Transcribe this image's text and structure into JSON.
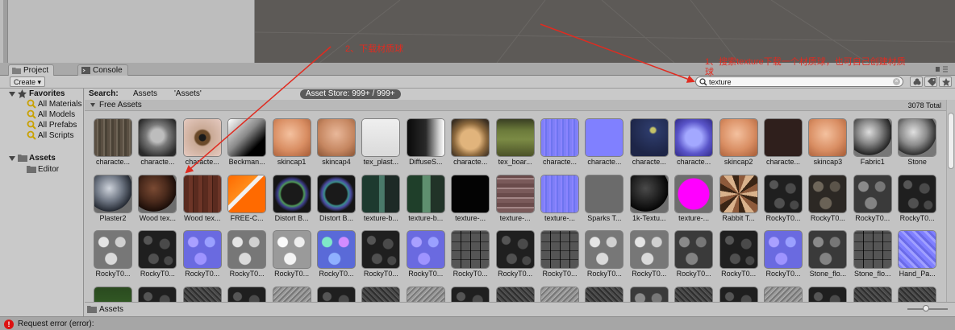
{
  "tabs": [
    {
      "label": "Project"
    },
    {
      "label": "Console"
    }
  ],
  "toolbar": {
    "create_label": "Create",
    "search_value": "texture"
  },
  "sidebar": {
    "favorites_label": "Favorites",
    "favorites": [
      "All Materials",
      "All Models",
      "All Prefabs",
      "All Scripts"
    ],
    "assets_label": "Assets",
    "assets_children": [
      "Editor"
    ]
  },
  "search_scope": {
    "label": "Search:",
    "assets": "Assets",
    "assets_quoted": "'Assets'",
    "asset_store": "Asset Store: 999+ / 999+"
  },
  "group": {
    "title": "Free Assets",
    "total": "3078 Total"
  },
  "assets": [
    {
      "label": "characte...",
      "tex": "bark"
    },
    {
      "label": "characte...",
      "tex": "face-dark"
    },
    {
      "label": "characte...",
      "tex": "eye"
    },
    {
      "label": "Beckman...",
      "tex": "grad-bw"
    },
    {
      "label": "skincap1",
      "tex": "skin"
    },
    {
      "label": "skincap4",
      "tex": "skin2"
    },
    {
      "label": "tex_plast...",
      "tex": "plastic"
    },
    {
      "label": "DiffuseS...",
      "tex": "diffuse"
    },
    {
      "label": "characte...",
      "tex": "face-tan"
    },
    {
      "label": "tex_boar...",
      "tex": "board"
    },
    {
      "label": "characte...",
      "tex": "normal"
    },
    {
      "label": "characte...",
      "tex": "normal-flat"
    },
    {
      "label": "characte...",
      "tex": "navy"
    },
    {
      "label": "characte...",
      "tex": "face-blue"
    },
    {
      "label": "skincap2",
      "tex": "skin"
    },
    {
      "label": "characte...",
      "tex": "dark-brown"
    },
    {
      "label": "skincap3",
      "tex": "skin"
    },
    {
      "label": "Fabric1",
      "tex": "sphere-gray"
    },
    {
      "label": "Stone",
      "tex": "sphere-stone"
    },
    {
      "label": "Plaster2",
      "tex": "sphere-plaster"
    },
    {
      "label": "Wood tex...",
      "tex": "sphere-wood"
    },
    {
      "label": "Wood tex...",
      "tex": "planks"
    },
    {
      "label": "FREE-C...",
      "tex": "orange-uv"
    },
    {
      "label": "Distort B...",
      "tex": "ring"
    },
    {
      "label": "Distort B...",
      "tex": "ring2"
    },
    {
      "label": "texture-b...",
      "tex": "bottle"
    },
    {
      "label": "texture-b...",
      "tex": "bottle2"
    },
    {
      "label": "texture-...",
      "tex": "black"
    },
    {
      "label": "texture-...",
      "tex": "brick"
    },
    {
      "label": "texture-...",
      "tex": "normal"
    },
    {
      "label": "Sparks T...",
      "tex": "gray"
    },
    {
      "label": "1k-Textu...",
      "tex": "sphere-dark"
    },
    {
      "label": "texture-...",
      "tex": "magenta"
    },
    {
      "label": "Rabbit T...",
      "tex": "rabbit"
    },
    {
      "label": "RockyT0...",
      "tex": "rock-dark"
    },
    {
      "label": "RockyT0...",
      "tex": "rock-brown"
    },
    {
      "label": "RockyT0...",
      "tex": "rock-gray"
    },
    {
      "label": "RockyT0...",
      "tex": "rock-dark"
    },
    {
      "label": "RockyT0...",
      "tex": "rock-light"
    },
    {
      "label": "RockyT0...",
      "tex": "rock-dark"
    },
    {
      "label": "RockyT0...",
      "tex": "rock-normal"
    },
    {
      "label": "RockyT0...",
      "tex": "rock-light"
    },
    {
      "label": "RockyT0...",
      "tex": "rock-white"
    },
    {
      "label": "RockyT0...",
      "tex": "rock-rainbow"
    },
    {
      "label": "RockyT0...",
      "tex": "rock-dark"
    },
    {
      "label": "RockyT0...",
      "tex": "rock-normal"
    },
    {
      "label": "RockyT0...",
      "tex": "tile-gray"
    },
    {
      "label": "RockyT0...",
      "tex": "rock-dark"
    },
    {
      "label": "RockyT0...",
      "tex": "tile-gray"
    },
    {
      "label": "RockyT0...",
      "tex": "rock-light"
    },
    {
      "label": "RockyT0...",
      "tex": "rock-light"
    },
    {
      "label": "RockyT0...",
      "tex": "rock-gray"
    },
    {
      "label": "RockyT0...",
      "tex": "rock-dark"
    },
    {
      "label": "RockyT0...",
      "tex": "rock-normal"
    },
    {
      "label": "Stone_flo...",
      "tex": "rock-gray"
    },
    {
      "label": "Stone_flo...",
      "tex": "tile-gray"
    },
    {
      "label": "Hand_Pa...",
      "tex": "normal-wave"
    },
    {
      "label": "",
      "tex": "grass"
    },
    {
      "label": "",
      "tex": "rock-dark"
    },
    {
      "label": "",
      "tex": "noise"
    },
    {
      "label": "",
      "tex": "rock-dark"
    },
    {
      "label": "",
      "tex": "noise-light"
    },
    {
      "label": "",
      "tex": "rock-dark"
    },
    {
      "label": "",
      "tex": "noise"
    },
    {
      "label": "",
      "tex": "noise-light"
    },
    {
      "label": "",
      "tex": "rock-dark"
    },
    {
      "label": "",
      "tex": "noise"
    },
    {
      "label": "",
      "tex": "noise-light"
    },
    {
      "label": "",
      "tex": "noise"
    },
    {
      "label": "",
      "tex": "rock-gray"
    },
    {
      "label": "",
      "tex": "noise"
    },
    {
      "label": "",
      "tex": "rock-dark"
    },
    {
      "label": "",
      "tex": "noise-light"
    },
    {
      "label": "",
      "tex": "rock-dark"
    },
    {
      "label": "",
      "tex": "noise"
    },
    {
      "label": "",
      "tex": "noise"
    }
  ],
  "pathbar": {
    "label": "Assets"
  },
  "status": {
    "message": "Request error (error):"
  },
  "annotations": {
    "step1": "1、搜索texture下载一个材质球，也可自己创建材质",
    "step1_tail": "球",
    "step2": "2、下载材质球"
  },
  "colors": {
    "annotation": "#e02b20",
    "asset_store_pill": "#5a5a5a",
    "error": "#dd1111"
  }
}
